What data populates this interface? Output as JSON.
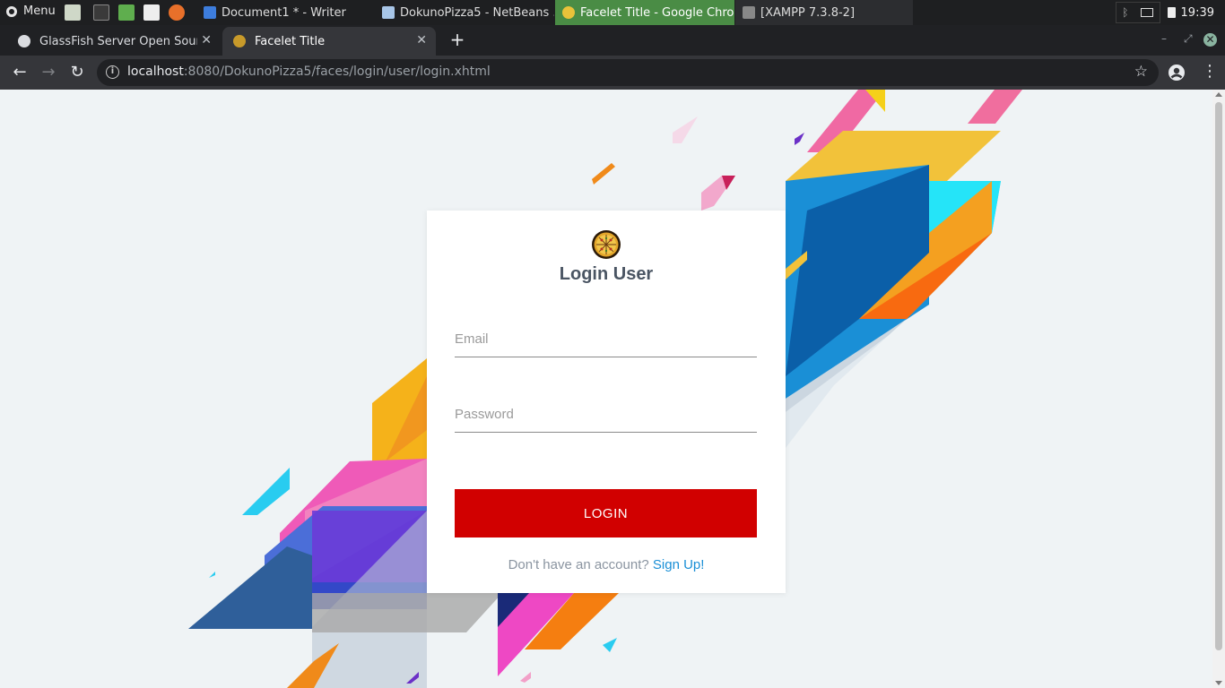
{
  "taskbar": {
    "menu_label": "Menu",
    "windows": [
      {
        "title": "Document1 * - Writer",
        "icon": "writer-icon",
        "color": "#3d7ddd"
      },
      {
        "title": "DokunoPizza5 - NetBeans ...",
        "icon": "netbeans-icon",
        "color": "#a8c6e8"
      },
      {
        "title": "Facelet Title - Google Chro...",
        "icon": "chrome-icon",
        "color": "#4a8c45"
      },
      {
        "title": "[XAMPP 7.3.8-2]",
        "icon": "terminal-window-icon",
        "color": "#888888"
      }
    ],
    "clock": "19:39"
  },
  "browser": {
    "tabs": [
      {
        "title": "GlassFish Server Open Source Edition",
        "icon": "globe-icon",
        "active": false
      },
      {
        "title": "Facelet Title",
        "icon": "pizza-favicon",
        "active": true
      }
    ],
    "url_host": "localhost",
    "url_rest": ":8080/DokunoPizza5/faces/login/user/login.xhtml"
  },
  "login": {
    "title": "Login User",
    "email_placeholder": "Email",
    "password_placeholder": "Password",
    "login_button": "LOGIN",
    "signup_prompt": "Don't have an account?",
    "signup_link": "Sign Up!"
  },
  "colors": {
    "accent_red": "#d10000",
    "link_blue": "#1a8fd6",
    "active_window_green": "#4a8c45"
  }
}
